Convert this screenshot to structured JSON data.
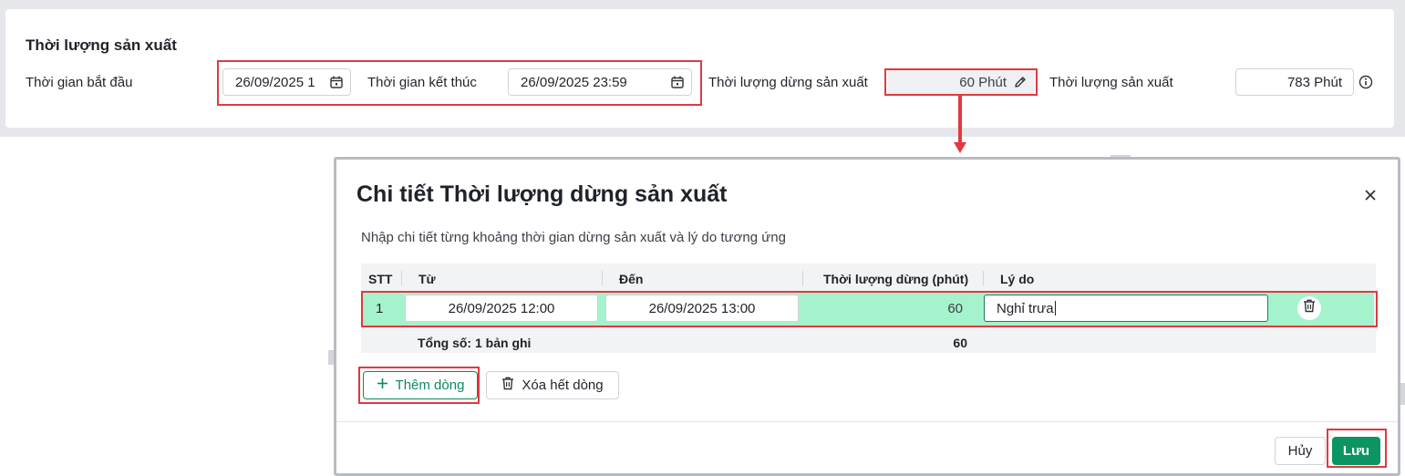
{
  "panel": {
    "title": "Thời lượng sản xuất",
    "start_label": "Thời gian bắt đầu",
    "start_value": "26/09/2025 1",
    "end_label": "Thời gian kết thúc",
    "end_value": "26/09/2025 23:59",
    "stop_label": "Thời lượng dừng sản xuất",
    "stop_value": "60 Phút",
    "prod_label": "Thời lượng sản xuất",
    "prod_value": "783 Phút"
  },
  "dialog": {
    "title": "Chi tiết Thời lượng dừng sản xuất",
    "subtitle": "Nhập chi tiết từng khoảng thời gian dừng sản xuất và lý do tương ứng",
    "columns": [
      "STT",
      "Từ",
      "Đến",
      "Thời lượng dừng (phút)",
      "Lý do"
    ],
    "rows": [
      {
        "stt": "1",
        "from": "26/09/2025 12:00",
        "to": "26/09/2025 13:00",
        "duration": "60",
        "reason": "Nghỉ trưa"
      }
    ],
    "total_label": "Tổng số: 1 bản ghi",
    "total_value": "60",
    "add_row_label": "Thêm dòng",
    "clear_rows_label": "Xóa hết dòng",
    "cancel_label": "Hủy",
    "save_label": "Lưu"
  },
  "colors": {
    "accent": "#0c9463",
    "highlight": "#e2393f",
    "row_selected": "#a5f3cd"
  }
}
